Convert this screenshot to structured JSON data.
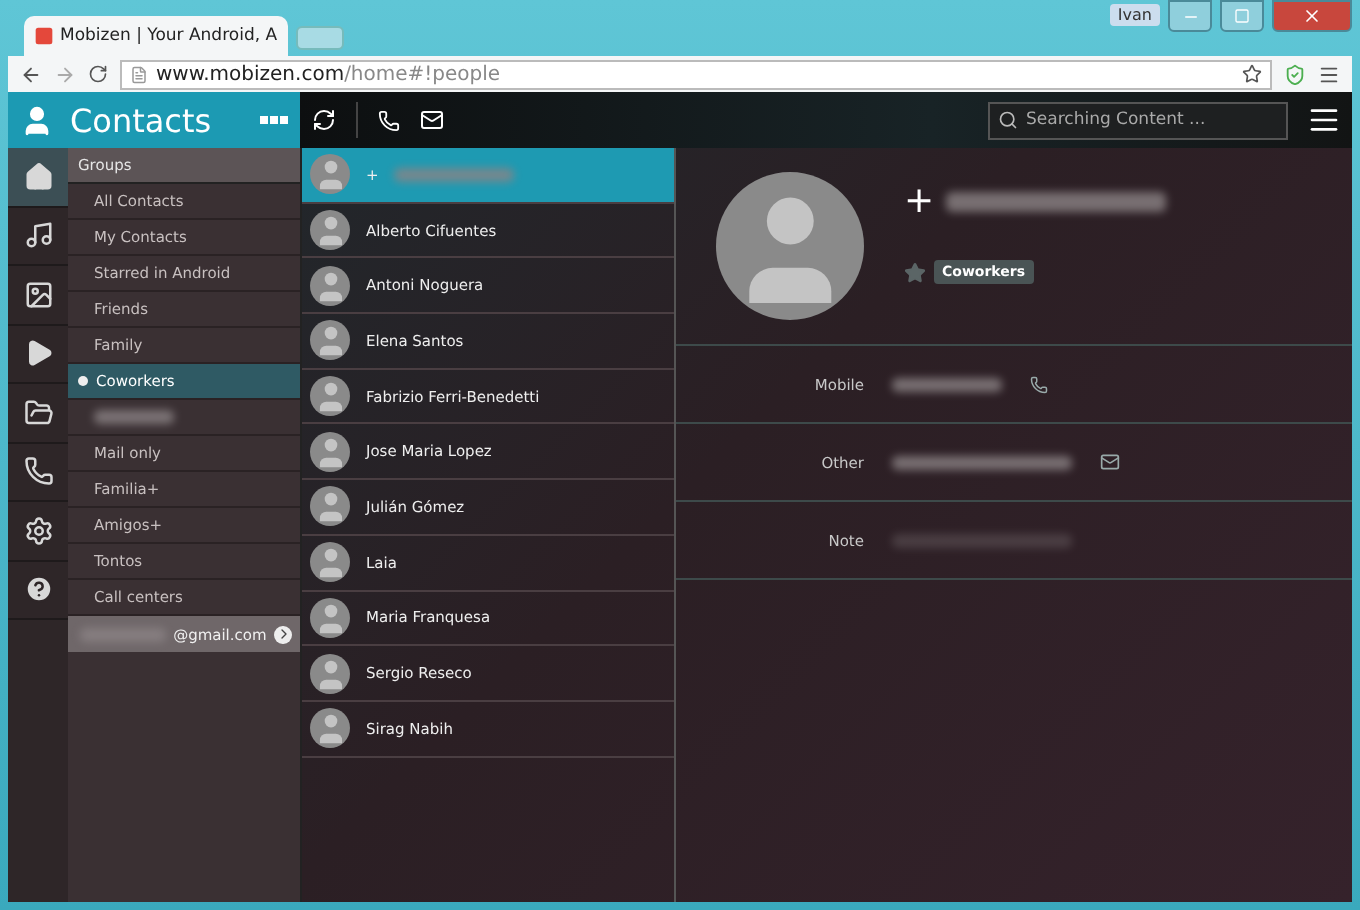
{
  "browser": {
    "tab_title": "Mobizen | Your Android, A",
    "user": "Ivan",
    "url_host": "www.mobizen.com",
    "url_path": "/home#!people"
  },
  "app": {
    "title": "Contacts",
    "search": {
      "placeholder": "Searching Content ..."
    }
  },
  "nav": [
    {
      "kind": "home",
      "selected": true
    },
    {
      "kind": "music",
      "selected": false
    },
    {
      "kind": "image",
      "selected": false
    },
    {
      "kind": "video",
      "selected": false
    },
    {
      "kind": "folder",
      "selected": false
    },
    {
      "kind": "phone",
      "selected": false
    },
    {
      "kind": "settings",
      "selected": false
    },
    {
      "kind": "help",
      "selected": false
    }
  ],
  "groups": {
    "header": "Groups",
    "items": [
      {
        "kind": "item",
        "label": "All Contacts",
        "selected": false
      },
      {
        "kind": "item",
        "label": "My Contacts",
        "selected": false
      },
      {
        "kind": "item",
        "label": "Starred in Android",
        "selected": false
      },
      {
        "kind": "item",
        "label": "Friends",
        "selected": false
      },
      {
        "kind": "item",
        "label": "Family",
        "selected": false
      },
      {
        "kind": "item",
        "label": "Coworkers",
        "selected": true
      },
      {
        "kind": "hidden",
        "selected": false
      },
      {
        "kind": "item",
        "label": "Mail only",
        "selected": false
      },
      {
        "kind": "item",
        "label": "Familia+",
        "selected": false
      },
      {
        "kind": "item",
        "label": "Amigos+",
        "selected": false
      },
      {
        "kind": "item",
        "label": "Tontos",
        "selected": false
      },
      {
        "kind": "item",
        "label": "Call centers",
        "selected": false
      },
      {
        "kind": "account",
        "label": "@gmail.com"
      }
    ]
  },
  "contacts": [
    {
      "name": "+",
      "selected": true
    },
    {
      "name": "Alberto Cifuentes",
      "selected": false
    },
    {
      "name": "Antoni Noguera",
      "selected": false
    },
    {
      "name": "Elena Santos",
      "selected": false
    },
    {
      "name": "Fabrizio Ferri-Benedetti",
      "selected": false
    },
    {
      "name": "Jose Maria Lopez",
      "selected": false
    },
    {
      "name": "Julián Gómez",
      "selected": false
    },
    {
      "name": "Laia",
      "selected": false
    },
    {
      "name": "Maria Franquesa",
      "selected": false
    },
    {
      "name": "Sergio Reseco",
      "selected": false
    },
    {
      "name": "Sirag Nabih",
      "selected": false
    }
  ],
  "detail": {
    "name": "+",
    "starred": false,
    "tag": "Coworkers",
    "fields": [
      {
        "label": "Mobile",
        "kind": "phone"
      },
      {
        "label": "Other",
        "kind": "mail"
      },
      {
        "label": "Note",
        "kind": "note"
      }
    ]
  }
}
